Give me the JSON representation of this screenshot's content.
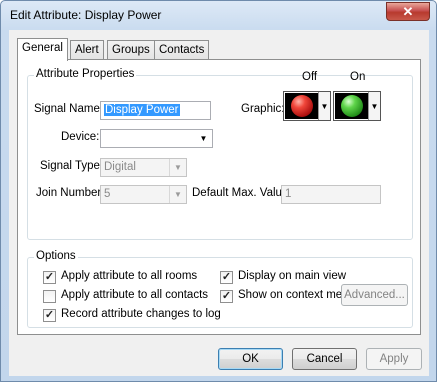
{
  "window": {
    "title": "Edit Attribute: Display Power",
    "close_glyph": "✕"
  },
  "tabs": [
    {
      "label": "General",
      "active": true
    },
    {
      "label": "Alert",
      "active": false
    },
    {
      "label": "Groups",
      "active": false
    },
    {
      "label": "Contacts",
      "active": false
    }
  ],
  "attribute_properties": {
    "title": "Attribute Properties",
    "signal_name_label": "Signal Name:",
    "signal_name_value": "Display Power",
    "device_label": "Device:",
    "device_value": "",
    "signal_type_label": "Signal Type:",
    "signal_type_value": "Digital",
    "join_number_label": "Join Number:",
    "join_number_value": "5",
    "default_max_label": "Default Max. Value:",
    "default_max_value": "1",
    "graphic_label": "Graphic:",
    "off_label": "Off",
    "on_label": "On",
    "off_color": "#d42020",
    "on_color": "#3fbf2f"
  },
  "options": {
    "title": "Options",
    "apply_all_rooms": {
      "label": "Apply attribute to all rooms",
      "checked": true
    },
    "apply_all_contacts": {
      "label": "Apply attribute to all contacts",
      "checked": false
    },
    "record_changes": {
      "label": "Record attribute changes to log",
      "checked": true
    },
    "display_main_view": {
      "label": "Display on main view",
      "checked": true
    },
    "show_context_menu": {
      "label": "Show on context menu",
      "checked": true
    },
    "advanced_label": "Advanced..."
  },
  "footer": {
    "ok_label": "OK",
    "cancel_label": "Cancel",
    "apply_label": "Apply"
  },
  "check_glyph": "✓",
  "dropdown_glyph": "▼"
}
